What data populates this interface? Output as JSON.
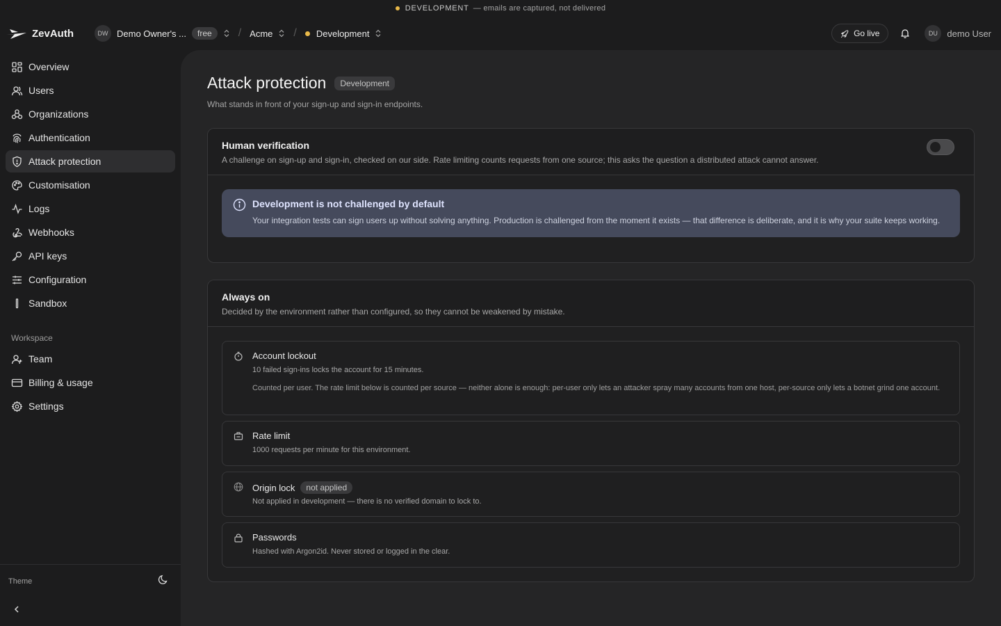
{
  "banner": {
    "env": "DEVELOPMENT",
    "note": "— emails are captured, not delivered"
  },
  "header": {
    "app_name": "ZevAuth",
    "workspace_initials": "DW",
    "workspace_name": "Demo Owner's ...",
    "plan": "free",
    "project": "Acme",
    "environment": "Development",
    "go_live": "Go live",
    "user_initials": "DU",
    "user_name": "demo User"
  },
  "sidebar": {
    "items": [
      {
        "label": "Overview"
      },
      {
        "label": "Users"
      },
      {
        "label": "Organizations"
      },
      {
        "label": "Authentication"
      },
      {
        "label": "Attack protection"
      },
      {
        "label": "Customisation"
      },
      {
        "label": "Logs"
      },
      {
        "label": "Webhooks"
      },
      {
        "label": "API keys"
      },
      {
        "label": "Configuration"
      },
      {
        "label": "Sandbox"
      }
    ],
    "workspace_label": "Workspace",
    "workspace_items": [
      {
        "label": "Team"
      },
      {
        "label": "Billing & usage"
      },
      {
        "label": "Settings"
      }
    ],
    "theme_label": "Theme"
  },
  "page": {
    "title": "Attack protection",
    "env_badge": "Development",
    "subtitle": "What stands in front of your sign-up and sign-in endpoints.",
    "human": {
      "title": "Human verification",
      "desc": "A challenge on sign-up and sign-in, checked on our side. Rate limiting counts requests from one source; this asks the question a distributed attack cannot answer.",
      "enabled": false,
      "info_title": "Development is not challenged by default",
      "info_text": "Your integration tests can sign users up without solving anything. Production is challenged from the moment it exists — that difference is deliberate, and it is why your suite keeps working."
    },
    "always_on": {
      "title": "Always on",
      "desc": "Decided by the environment rather than configured, so they cannot be weakened by mistake.",
      "items": [
        {
          "title": "Account lockout",
          "desc": "10 failed sign-ins locks the account for 15 minutes.",
          "detail": "Counted per user. The rate limit below is counted per source — neither alone is enough: per-user only lets an attacker spray many accounts from one host, per-source only lets a botnet grind one account."
        },
        {
          "title": "Rate limit",
          "desc": "1000 requests per minute for this environment."
        },
        {
          "title": "Origin lock",
          "badge": "not applied",
          "desc": "Not applied in development — there is no verified domain to lock to."
        },
        {
          "title": "Passwords",
          "desc": "Hashed with Argon2id. Never stored or logged in the clear."
        }
      ]
    }
  }
}
